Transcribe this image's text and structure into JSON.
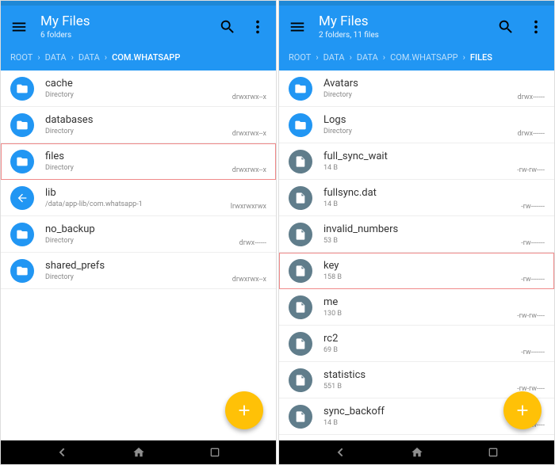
{
  "panes": [
    {
      "title": "My Files",
      "subtitle": "6 folders",
      "crumbs": [
        {
          "label": "ROOT",
          "active": false
        },
        {
          "label": "DATA",
          "active": false
        },
        {
          "label": "DATA",
          "active": false
        },
        {
          "label": "COM.WHATSAPP",
          "active": true
        }
      ],
      "items": [
        {
          "type": "folder",
          "name": "cache",
          "sub": "Directory",
          "perm": "drwxrwx--x",
          "hl": false
        },
        {
          "type": "folder",
          "name": "databases",
          "sub": "Directory",
          "perm": "drwxrwx--x",
          "hl": false
        },
        {
          "type": "folder",
          "name": "files",
          "sub": "Directory",
          "perm": "drwxrwx--x",
          "hl": true
        },
        {
          "type": "link",
          "name": "lib",
          "sub": "/data/app-lib/com.whatsapp-1",
          "perm": "lrwxrwxrwx",
          "hl": false
        },
        {
          "type": "folder",
          "name": "no_backup",
          "sub": "Directory",
          "perm": "drwx------",
          "hl": false
        },
        {
          "type": "folder",
          "name": "shared_prefs",
          "sub": "Directory",
          "perm": "drwxrwx--x",
          "hl": false
        }
      ]
    },
    {
      "title": "My Files",
      "subtitle": "2 folders, 11 files",
      "crumbs": [
        {
          "label": "ROOT",
          "active": false
        },
        {
          "label": "DATA",
          "active": false
        },
        {
          "label": "DATA",
          "active": false
        },
        {
          "label": "COM.WHATSAPP",
          "active": false
        },
        {
          "label": "FILES",
          "active": true
        }
      ],
      "items": [
        {
          "type": "folder",
          "name": "Avatars",
          "sub": "Directory",
          "perm": "drwx------",
          "hl": false
        },
        {
          "type": "folder",
          "name": "Logs",
          "sub": "Directory",
          "perm": "drwx------",
          "hl": false
        },
        {
          "type": "file",
          "name": "full_sync_wait",
          "sub": "14 B",
          "perm": "-rw-rw----",
          "hl": false
        },
        {
          "type": "file",
          "name": "fullsync.dat",
          "sub": "14 B",
          "perm": "-rw-------",
          "hl": false
        },
        {
          "type": "file",
          "name": "invalid_numbers",
          "sub": "53 B",
          "perm": "-rw-------",
          "hl": false
        },
        {
          "type": "file",
          "name": "key",
          "sub": "158 B",
          "perm": "-rw-------",
          "hl": true
        },
        {
          "type": "file",
          "name": "me",
          "sub": "130 B",
          "perm": "-rw-rw----",
          "hl": false
        },
        {
          "type": "file",
          "name": "rc2",
          "sub": "69 B",
          "perm": "-rw-------",
          "hl": false
        },
        {
          "type": "file",
          "name": "statistics",
          "sub": "551 B",
          "perm": "-rw-rw----",
          "hl": false
        },
        {
          "type": "file",
          "name": "sync_backoff",
          "sub": "14 B",
          "perm": "-rw-rw----",
          "hl": false
        }
      ]
    }
  ]
}
